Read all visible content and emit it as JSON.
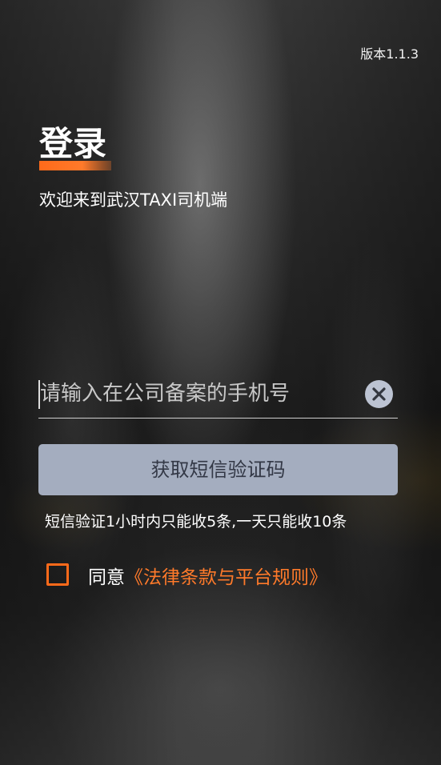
{
  "header": {
    "version": "版本1.1.3"
  },
  "login": {
    "title": "登录",
    "welcome": "欢迎来到武汉TAXI司机端"
  },
  "phone": {
    "placeholder": "请输入在公司备案的手机号",
    "value": "",
    "clear_icon": "clear-icon"
  },
  "sms": {
    "button_label": "获取短信验证码",
    "note": "短信验证1小时内只能收5条,一天只能收10条"
  },
  "agreement": {
    "prefix": "同意",
    "link_text": "《法律条款与平台规则》",
    "checked": false
  },
  "colors": {
    "accent": "#ff6a1a",
    "button_bg": "#a4adbf",
    "button_text": "#333846"
  }
}
